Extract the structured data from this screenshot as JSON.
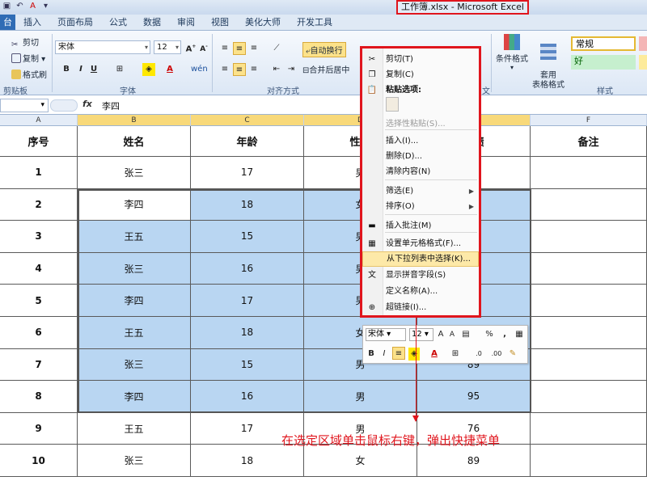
{
  "window": {
    "title": "工作簿.xlsx - Microsoft Excel"
  },
  "tabs": [
    "台",
    "插入",
    "页面布局",
    "公式",
    "数据",
    "审阅",
    "视图",
    "美化大师",
    "开发工具"
  ],
  "ribbon": {
    "clipboard": {
      "cut": "剪切",
      "copy": "复制",
      "format_painter": "格式刷",
      "group": "剪贴板"
    },
    "font": {
      "name": "宋体",
      "size": "12",
      "group": "字体"
    },
    "alignment": {
      "wrap": "自动换行",
      "merge": "合并后居中",
      "group": "对齐方式"
    },
    "styles": {
      "cond_format": "条件格式",
      "table_format": "套用\n表格格式",
      "normal": "常规",
      "good": "好",
      "group": "样式"
    },
    "number_group": "文"
  },
  "formula_bar": {
    "fx": "fx",
    "value": "李四"
  },
  "columns": [
    "A",
    "B",
    "C",
    "D",
    "E",
    "F"
  ],
  "table": {
    "headers": [
      "序号",
      "姓名",
      "年龄",
      "性别",
      "成绩",
      "备注"
    ],
    "rows": [
      [
        "1",
        "张三",
        "17",
        "男",
        "",
        ""
      ],
      [
        "2",
        "李四",
        "18",
        "女",
        "",
        ""
      ],
      [
        "3",
        "王五",
        "15",
        "男",
        "",
        ""
      ],
      [
        "4",
        "张三",
        "16",
        "男",
        "",
        ""
      ],
      [
        "5",
        "李四",
        "17",
        "男",
        "",
        ""
      ],
      [
        "6",
        "王五",
        "18",
        "女",
        "",
        ""
      ],
      [
        "7",
        "张三",
        "15",
        "男",
        "89",
        ""
      ],
      [
        "8",
        "李四",
        "16",
        "男",
        "95",
        ""
      ],
      [
        "9",
        "王五",
        "17",
        "男",
        "76",
        ""
      ],
      [
        "10",
        "张三",
        "18",
        "女",
        "89",
        ""
      ]
    ]
  },
  "context_menu": {
    "items": [
      {
        "label": "剪切(T)",
        "icon": "scissors-icon",
        "state": "normal"
      },
      {
        "label": "复制(C)",
        "icon": "copy-icon",
        "state": "normal"
      },
      {
        "label": "粘贴选项:",
        "icon": "paste-icon",
        "state": "bold"
      },
      {
        "label": "选择性粘贴(S)...",
        "icon": "",
        "state": "disabled"
      },
      {
        "label": "插入(I)...",
        "icon": "",
        "state": "normal"
      },
      {
        "label": "删除(D)...",
        "icon": "",
        "state": "normal"
      },
      {
        "label": "清除内容(N)",
        "icon": "",
        "state": "normal"
      },
      {
        "label": "筛选(E)",
        "icon": "",
        "state": "submenu"
      },
      {
        "label": "排序(O)",
        "icon": "",
        "state": "submenu"
      },
      {
        "label": "插入批注(M)",
        "icon": "comment-icon",
        "state": "normal"
      },
      {
        "label": "设置单元格格式(F)...",
        "icon": "format-cells-icon",
        "state": "normal"
      },
      {
        "label": "从下拉列表中选择(K)...",
        "icon": "",
        "state": "active"
      },
      {
        "label": "显示拼音字段(S)",
        "icon": "phonetic-icon",
        "state": "normal"
      },
      {
        "label": "定义名称(A)...",
        "icon": "",
        "state": "normal"
      },
      {
        "label": "超链接(I)...",
        "icon": "hyperlink-icon",
        "state": "normal"
      }
    ]
  },
  "mini_toolbar": {
    "font": "宋体",
    "size": "12",
    "percent": "%",
    "comma": ","
  },
  "annotation": {
    "text": "在选定区域单击鼠标右键，弹出快捷菜单"
  },
  "colors": {
    "accent_red": "#e0151d",
    "selection_blue": "#b9d6f2",
    "header_gold": "#f8d97a"
  }
}
